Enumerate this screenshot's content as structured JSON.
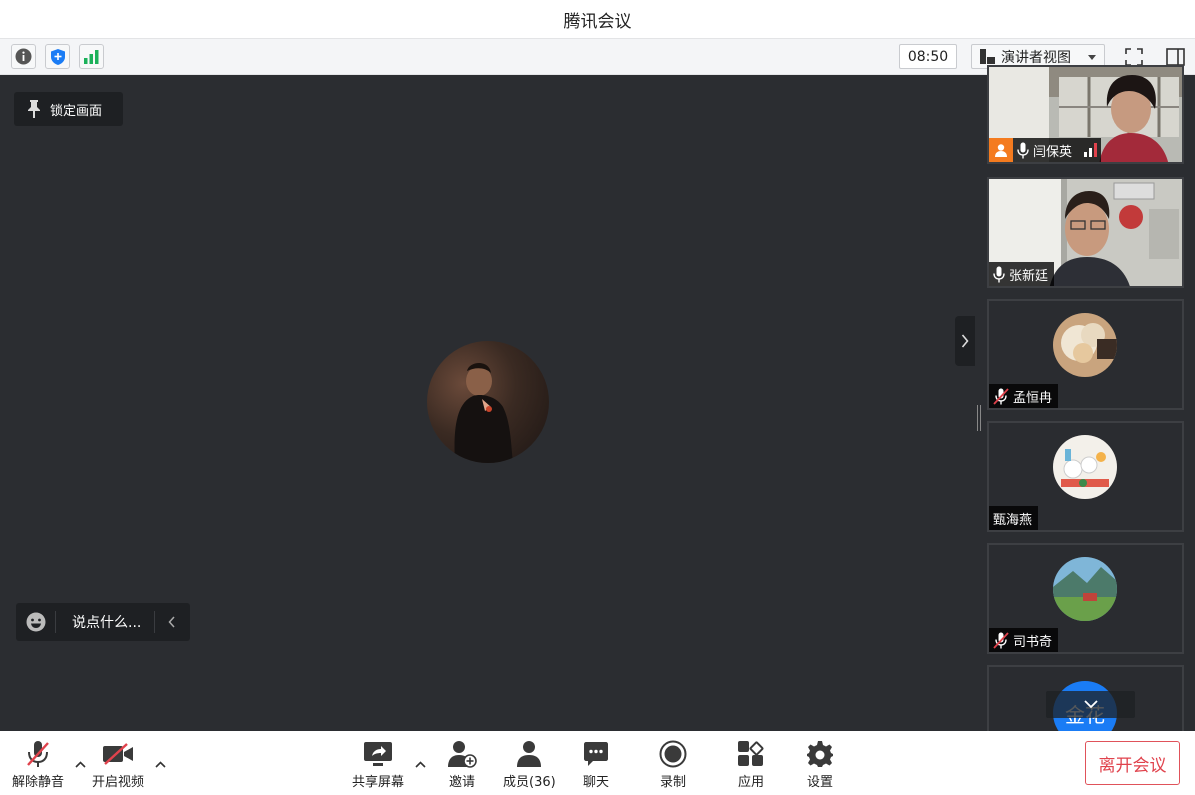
{
  "window": {
    "title": "腾讯会议"
  },
  "toolbar": {
    "time": "08:50",
    "view_mode": "演讲者视图"
  },
  "stage": {
    "lock_label": "锁定画面",
    "chat_placeholder": "说点什么..."
  },
  "participants": [
    {
      "name": "闫保英",
      "mic": "on",
      "video": "on",
      "host": true
    },
    {
      "name": "张新廷",
      "mic": "on",
      "video": "on",
      "host": false
    },
    {
      "name": "孟恒冉",
      "mic": "muted",
      "video": "off",
      "host": false
    },
    {
      "name": "甄海燕",
      "mic": "none",
      "video": "off",
      "host": false
    },
    {
      "name": "司书奇",
      "mic": "muted",
      "video": "off",
      "host": false
    },
    {
      "name": "金花",
      "mic": "none",
      "video": "off",
      "host": false
    }
  ],
  "bottombar": {
    "unmute": "解除静音",
    "start_video": "开启视频",
    "share_screen": "共享屏幕",
    "invite": "邀请",
    "members": "成员(36)",
    "chat": "聊天",
    "record": "录制",
    "apps": "应用",
    "settings": "设置",
    "leave": "离开会议"
  },
  "colors": {
    "accent_blue": "#1a7cf5",
    "leave_red": "#e0424c",
    "stage_bg": "#2b2d31",
    "host_orange": "#f47b1f",
    "signal_green": "#1bb15a"
  }
}
